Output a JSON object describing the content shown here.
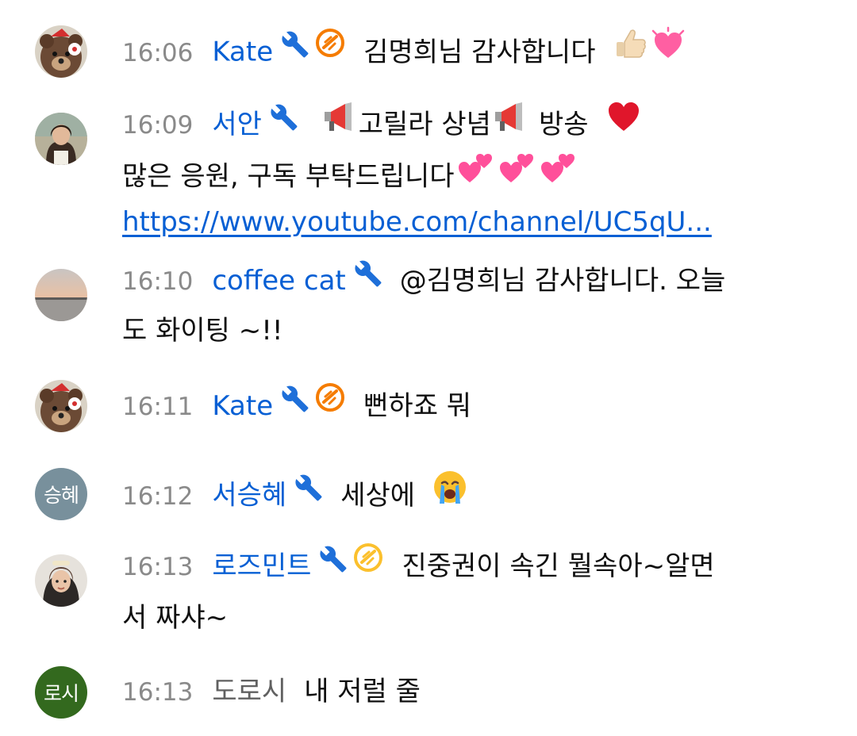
{
  "messages": [
    {
      "time": "16:06",
      "author": "Kate",
      "text": "김명희님 감사합니다",
      "avatar": "bear-avatar"
    },
    {
      "time": "16:09",
      "author": "서안",
      "text_a": "고릴라 상념",
      "text_b": "방송",
      "line2": "많은 응원, 구독 부탁드립니다",
      "link": "https://www.youtube.com/channel/UC5qU...",
      "avatar": "photo-avatar"
    },
    {
      "time": "16:10",
      "author": "coffee cat",
      "text": "@김명희님 감사합니다. 오늘",
      "line2": "도 화이팅 ~!!",
      "avatar": "sunset-avatar"
    },
    {
      "time": "16:11",
      "author": "Kate",
      "text": "뻔하죠 뭐",
      "avatar": "bear-avatar"
    },
    {
      "time": "16:12",
      "author": "서승혜",
      "text": "세상에",
      "avatar_text": "승혜",
      "avatar_color": "#78909c"
    },
    {
      "time": "16:13",
      "author": "로즈민트",
      "text": "진중권이 속긴 뭘속아~알면",
      "line2": "서 짜샤~",
      "avatar": "portrait-avatar"
    },
    {
      "time": "16:13",
      "author": "도로시",
      "text": "내 저럴 줄",
      "avatar_text": "로시",
      "avatar_color": "#33691e"
    }
  ],
  "colors": {
    "author": "#065fd4",
    "time": "#8a8a8a",
    "plain_author": "#606060",
    "badge_orange": "#f57c00",
    "badge_yellow": "#fbc02d"
  },
  "icons": [
    "wrench-icon",
    "member-badge-icon",
    "megaphone-icon",
    "heart-icon",
    "thumbs-up-icon",
    "crying-face-icon",
    "sparkling-heart-icon",
    "two-hearts-icon"
  ]
}
